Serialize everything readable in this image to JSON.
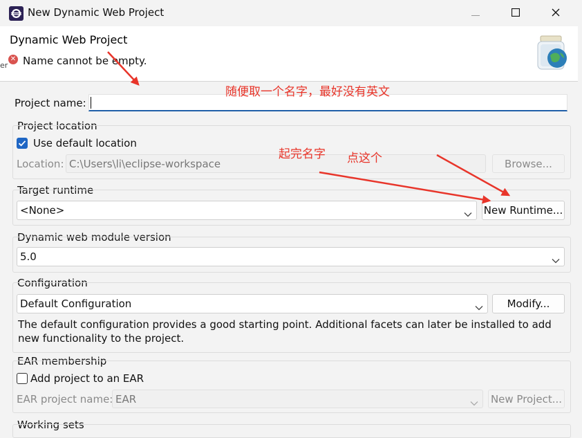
{
  "window": {
    "title": "New Dynamic Web Project",
    "controls": {
      "minimize_icon": "minimize-icon",
      "maximize_icon": "maximize-icon",
      "close_icon": "close-icon"
    }
  },
  "banner": {
    "title": "Dynamic Web Project",
    "message": "Name cannot be empty.",
    "message_icon": "error-icon",
    "wizard_image": "web-project-globe-icon"
  },
  "project_name": {
    "label": "Project name:",
    "value": ""
  },
  "project_location": {
    "group_label": "Project location",
    "use_default_label": "Use default location",
    "use_default_checked": true,
    "location_label": "Location:",
    "location_value": "C:\\Users\\li\\eclipse-workspace",
    "browse_label": "Browse..."
  },
  "target_runtime": {
    "group_label": "Target runtime",
    "selected": "<None>",
    "new_runtime_label": "New Runtime..."
  },
  "module_version": {
    "group_label": "Dynamic web module version",
    "selected": "5.0"
  },
  "configuration": {
    "group_label": "Configuration",
    "selected": "Default Configuration",
    "modify_label": "Modify...",
    "description": "The default configuration provides a good starting point. Additional facets can later be installed to add new functionality to the project."
  },
  "ear": {
    "group_label": "EAR membership",
    "add_label": "Add project to an EAR",
    "add_checked": false,
    "ear_name_label": "EAR project name:",
    "ear_name_value": "EAR",
    "new_project_label": "New Project..."
  },
  "working_sets": {
    "group_label": "Working sets"
  },
  "annotations": {
    "name_hint": "随便取一个名字，最好没有英文",
    "after_name": "起完名字",
    "click_this": "点这个"
  },
  "colors": {
    "annotation_red": "#e8352a",
    "focus_blue": "#1f5fa8",
    "checkbox_blue": "#1f66c4"
  }
}
